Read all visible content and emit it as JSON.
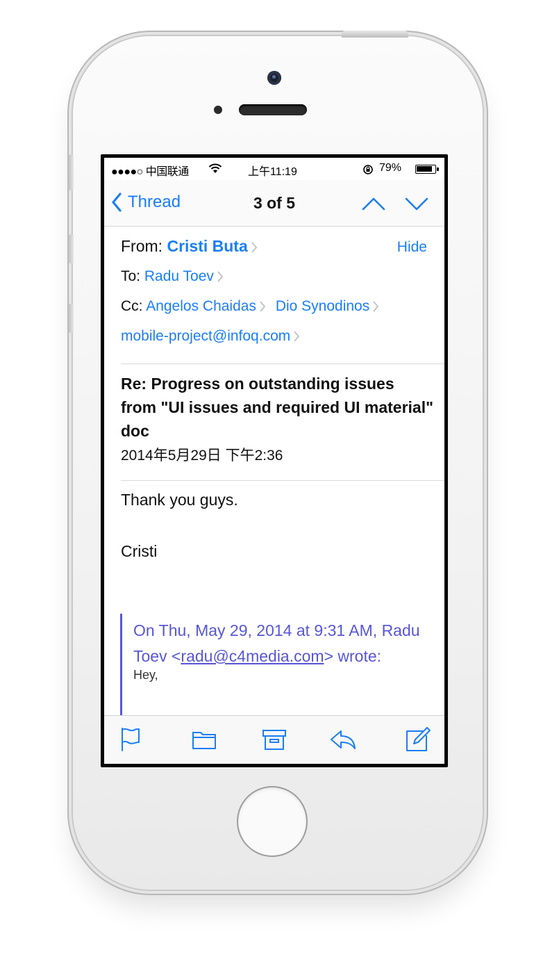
{
  "status_bar": {
    "carrier": "●●●●○ 中国联通",
    "time": "上午11:19",
    "battery": "79%"
  },
  "nav": {
    "back_label": "Thread",
    "title": "3 of 5"
  },
  "header": {
    "from_label": "From:",
    "from_name": "Cristi Buta",
    "hide_label": "Hide",
    "to_label": "To:",
    "to_name": "Radu Toev",
    "cc_label": "Cc:",
    "cc_names": [
      "Angelos Chaidas",
      "Dio Synodinos"
    ],
    "cc_email": "mobile-project@infoq.com"
  },
  "message": {
    "subject": "Re: Progress on outstanding issues from \"UI issues and required UI material\" doc",
    "date": "2014年5月29日 下午2:36",
    "body": [
      "Thank you guys.",
      "Cristi"
    ]
  },
  "quote": {
    "intro": "On Thu, May 29, 2014 at 9:31 AM, Radu Toev <",
    "email": "radu@c4media.com",
    "outro": "> wrote:",
    "first_line": "Hey,"
  },
  "toolbar": {
    "icons": [
      "flag-icon",
      "folder-icon",
      "archive-icon",
      "reply-icon",
      "compose-icon"
    ]
  },
  "colors": {
    "accent": "#1a7ef7",
    "quote": "#5856d6"
  }
}
